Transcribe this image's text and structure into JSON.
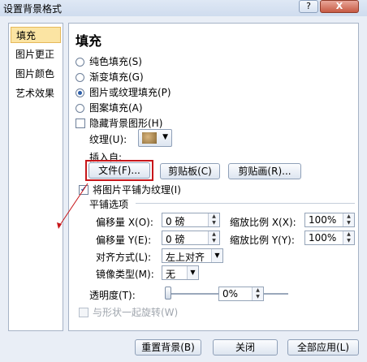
{
  "window": {
    "title": "设置背景格式",
    "help_label": "?",
    "close_label": "X"
  },
  "sidebar": {
    "items": [
      {
        "label": "填充",
        "selected": true
      },
      {
        "label": "图片更正"
      },
      {
        "label": "图片颜色"
      },
      {
        "label": "艺术效果"
      }
    ]
  },
  "fill": {
    "heading": "填充",
    "options": [
      {
        "label": "纯色填充(S)",
        "checked": false
      },
      {
        "label": "渐变填充(G)",
        "checked": false
      },
      {
        "label": "图片或纹理填充(P)",
        "checked": true
      },
      {
        "label": "图案填充(A)",
        "checked": false
      }
    ],
    "hide_bg_label": "隐藏背景图形(H)",
    "texture_label": "纹理(U):",
    "insert_from_label": "插入自:",
    "file_button": "文件(F)...",
    "clipboard_button": "剪贴板(C)",
    "clipart_button": "剪贴画(R)...",
    "tile_label": "将图片平铺为纹理(I)",
    "tile_checked": true,
    "tiling_heading": "平铺选项",
    "offset_x_label": "偏移量 X(O):",
    "offset_x_value": "0 磅",
    "offset_y_label": "偏移量 Y(E):",
    "offset_y_value": "0 磅",
    "scale_x_label": "缩放比例 X(X):",
    "scale_x_value": "100%",
    "scale_y_label": "缩放比例 Y(Y):",
    "scale_y_value": "100%",
    "align_label": "对齐方式(L):",
    "align_value": "左上对齐",
    "mirror_label": "镜像类型(M):",
    "mirror_value": "无",
    "transparency_label": "透明度(T):",
    "transparency_value": "0%",
    "rotate_label": "与形状一起旋转(W)"
  },
  "footer": {
    "reset_button": "重置背景(B)",
    "close_button": "关闭",
    "apply_all_button": "全部应用(L)"
  }
}
